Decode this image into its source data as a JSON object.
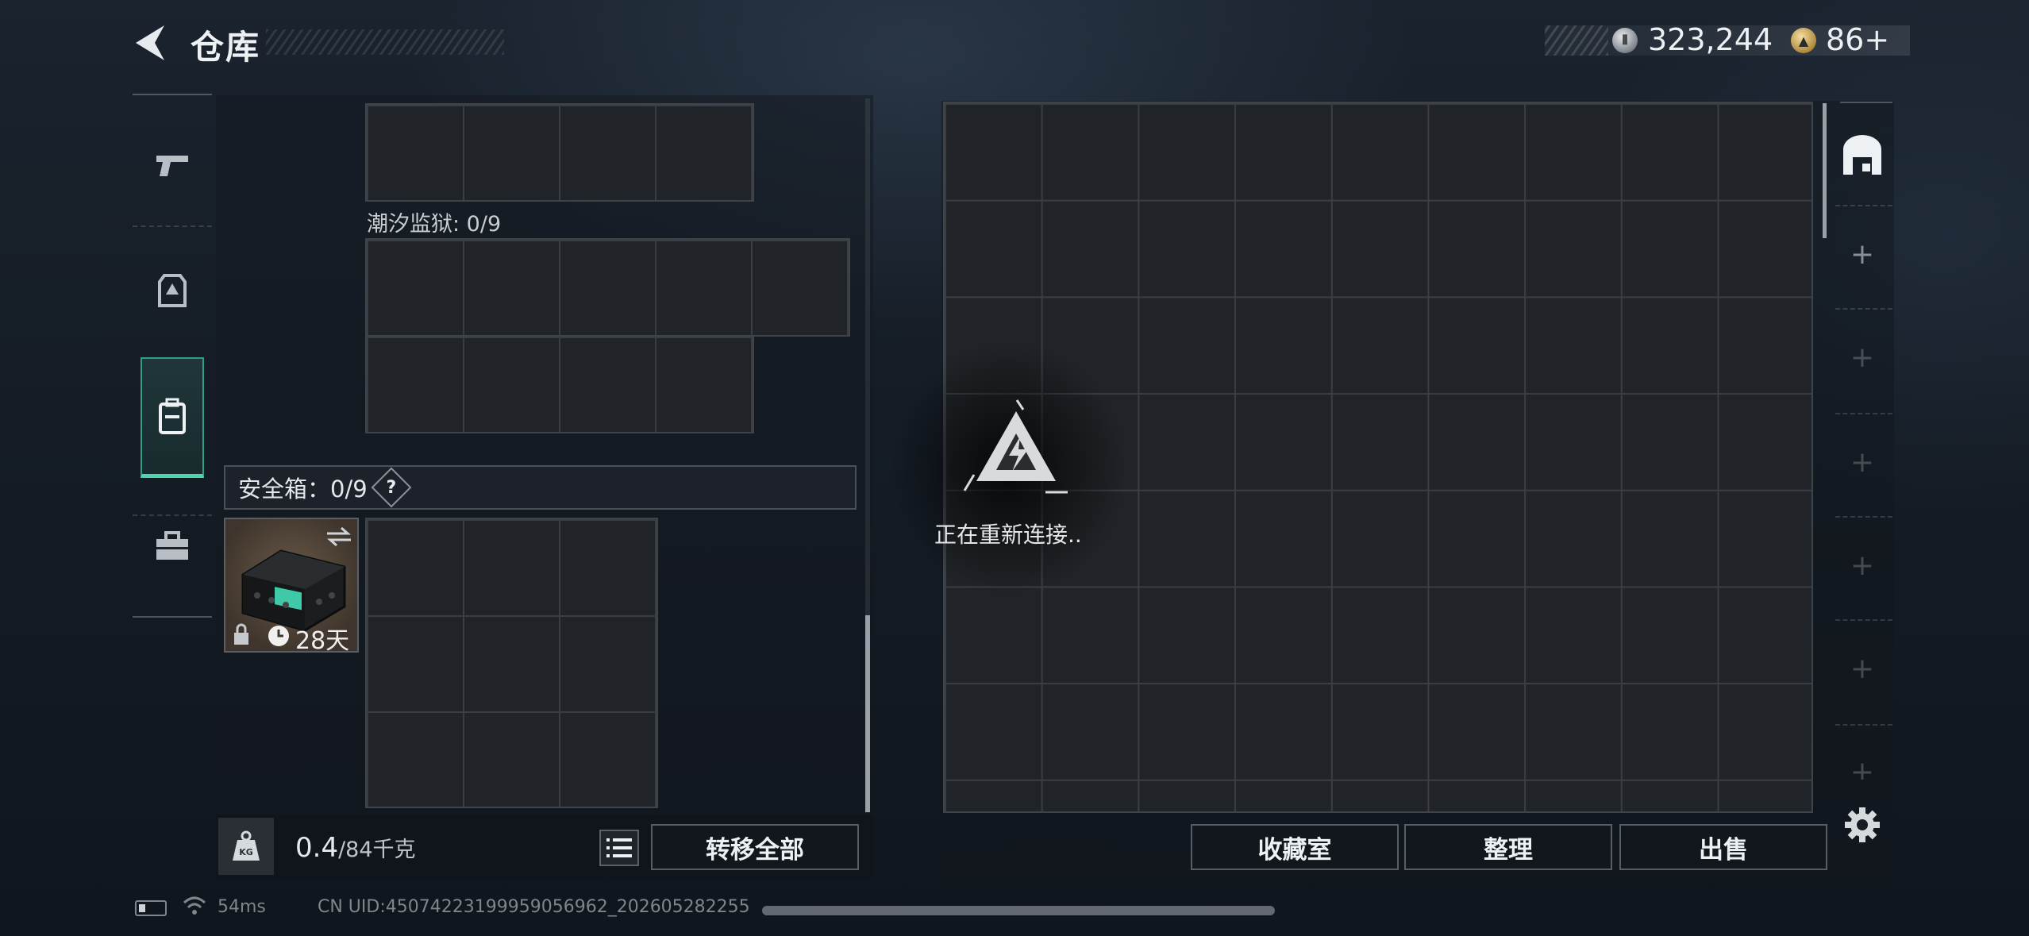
{
  "header": {
    "title": "仓库",
    "currencies": [
      {
        "icon": "silver-coin-icon",
        "value": "323,244"
      },
      {
        "icon": "gold-coin-icon",
        "value": "86+"
      }
    ]
  },
  "nav": {
    "items": [
      {
        "name": "weapons",
        "icon": "pistol-icon",
        "active": false
      },
      {
        "name": "armor",
        "icon": "armor-vest-icon",
        "active": false
      },
      {
        "name": "backpack",
        "icon": "backpack-icon",
        "active": true
      },
      {
        "name": "toolbox",
        "icon": "toolbox-icon",
        "active": false
      }
    ]
  },
  "left_panel": {
    "container_label": "潮汐监狱: 0/9",
    "safe_box_label": "安全箱：0/9",
    "safe_box_help": "?",
    "safe_box_item": {
      "name": "secure-case",
      "duration": "28天",
      "locked": true
    },
    "weight_value": "0.4",
    "weight_max": "/84千克",
    "transfer_all": "转移全部"
  },
  "right_panel": {
    "reconnect_text": "正在重新连接..",
    "buttons": [
      "收藏室",
      "整理",
      "出售"
    ]
  },
  "status_bar": {
    "ping": "54ms",
    "uid": "CN UID:4507422319995905696​2_202605282255"
  },
  "colors": {
    "accent": "#4fd4b1",
    "case_accent": "#3fc9a8"
  }
}
